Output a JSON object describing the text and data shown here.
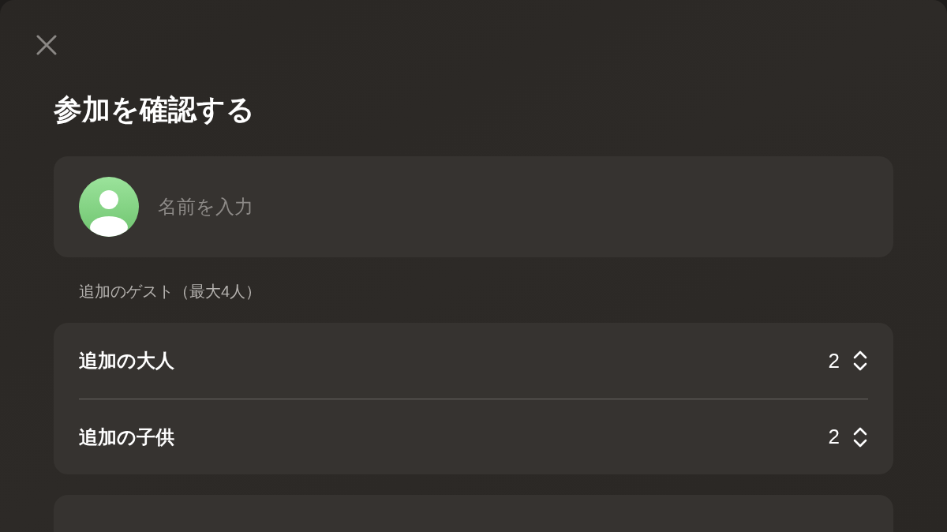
{
  "dialog": {
    "title": "参加を確認する"
  },
  "name_field": {
    "placeholder": "名前を入力"
  },
  "guests": {
    "label": "追加のゲスト（最大4人）",
    "rows": [
      {
        "label": "追加の大人",
        "value": "2"
      },
      {
        "label": "追加の子供",
        "value": "2"
      }
    ]
  }
}
